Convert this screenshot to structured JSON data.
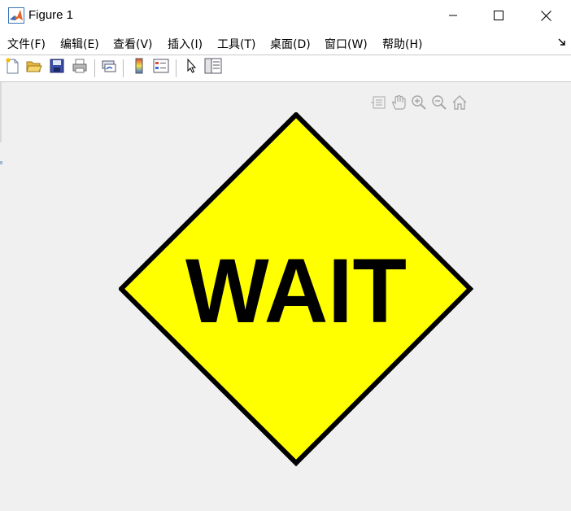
{
  "window": {
    "title": "Figure 1",
    "icon": "matlab-logo-icon",
    "controls": [
      "minimize-icon",
      "maximize-icon",
      "close-icon"
    ]
  },
  "menu": {
    "items": [
      "文件(F)",
      "编辑(E)",
      "查看(V)",
      "插入(I)",
      "工具(T)",
      "桌面(D)",
      "窗口(W)",
      "帮助(H)"
    ],
    "overflow_icon": "dock-arrow-icon"
  },
  "toolbar": {
    "buttons": [
      "new-figure-icon",
      "open-file-icon",
      "save-icon",
      "print-icon",
      "link-plot-icon",
      "insert-colorbar-icon",
      "insert-legend-icon",
      "edit-plot-icon",
      "property-inspector-icon"
    ]
  },
  "axes_toolbar": {
    "buttons": [
      "export-icon",
      "pan-icon",
      "zoom-in-icon",
      "zoom-out-icon",
      "restore-view-icon"
    ]
  },
  "figure": {
    "sign_text": "WAIT",
    "sign_fill": "#ffff00",
    "sign_border": "#000000",
    "background": "#f0f0f0"
  }
}
